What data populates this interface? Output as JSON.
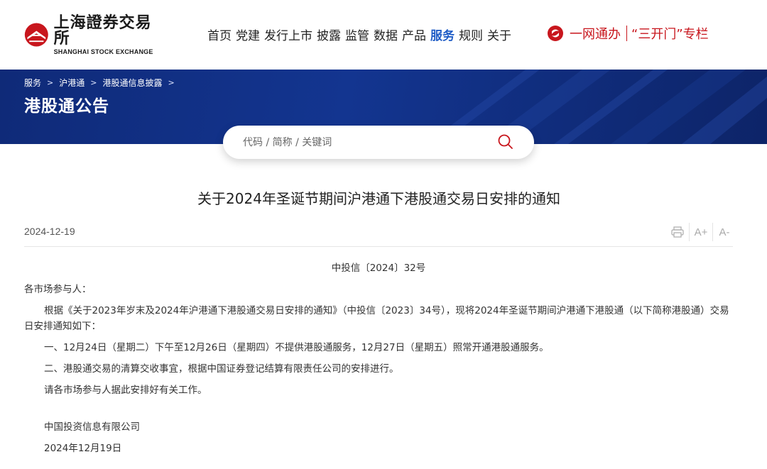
{
  "logo": {
    "name_cn": "上海證券交易所",
    "name_en": "SHANGHAI STOCK EXCHANGE",
    "icon": "sse-logo-icon"
  },
  "nav": {
    "items": [
      {
        "label": "首页",
        "active": false
      },
      {
        "label": "党建",
        "active": false
      },
      {
        "label": "发行上市",
        "active": false
      },
      {
        "label": "披露",
        "active": false
      },
      {
        "label": "监管",
        "active": false
      },
      {
        "label": "数据",
        "active": false
      },
      {
        "label": "产品",
        "active": false
      },
      {
        "label": "服务",
        "active": true
      },
      {
        "label": "规则",
        "active": false
      },
      {
        "label": "关于",
        "active": false
      }
    ],
    "active_color": "#1f5cc6"
  },
  "quick_links": {
    "icon": "one-net-icon",
    "one_net": "一网通办",
    "three_open": "“三开门”专栏",
    "color": "#c8161d"
  },
  "breadcrumb": [
    "服务",
    "沪港通",
    "港股通信息披露"
  ],
  "banner": {
    "title": "港股通公告",
    "bg_color": "#133590"
  },
  "search": {
    "placeholder": "代码 / 简称 / 关键词",
    "icon": "search-icon",
    "icon_color": "#c8161d"
  },
  "article": {
    "title": "关于2024年圣诞节期间沪港通下港股通交易日安排的通知",
    "date": "2024-12-19",
    "tools": {
      "print_icon": "print-icon",
      "font_increase": "A+",
      "font_decrease": "A-"
    },
    "doc_number": "中投信〔2024〕32号",
    "salutation": "各市场参与人：",
    "paragraphs": [
      "根据《关于2023年岁末及2024年沪港通下港股通交易日安排的通知》（中投信〔2023〕34号），现将2024年圣诞节期间沪港通下港股通（以下简称港股通）交易日安排通知如下：",
      "一、12月24日（星期二）下午至12月26日（星期四）不提供港股通服务，12月27日（星期五）照常开通港股通服务。",
      "二、港股通交易的清算交收事宜，根据中国证券登记结算有限责任公司的安排进行。",
      "请各市场参与人据此安排好有关工作。"
    ],
    "signer": "中国投资信息有限公司",
    "sign_date": "2024年12月19日"
  }
}
